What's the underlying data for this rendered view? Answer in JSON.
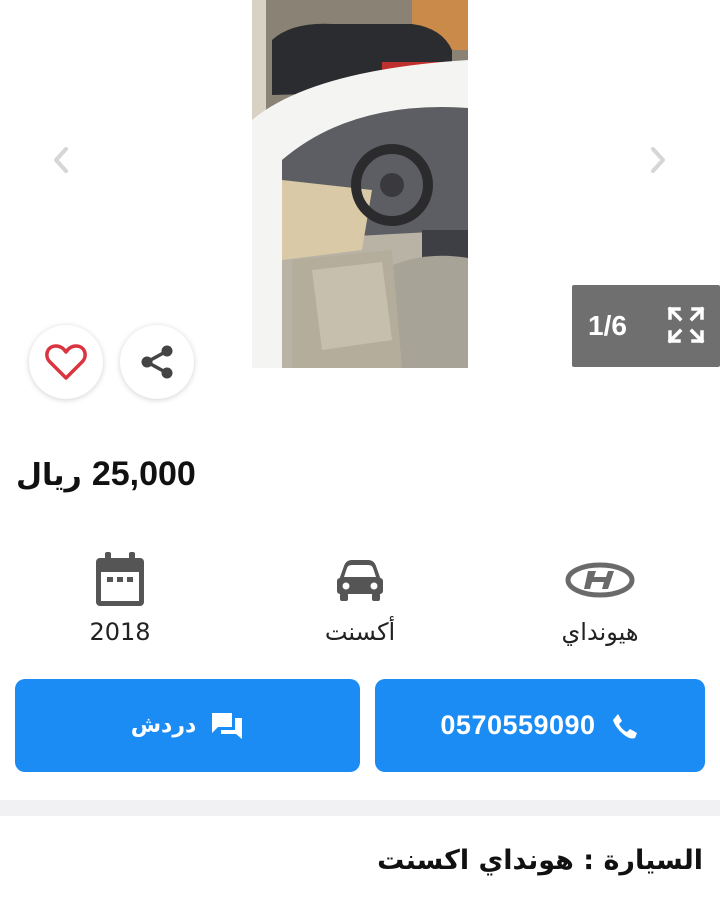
{
  "gallery": {
    "counter": "1/6",
    "prev_icon": "chevron-left-icon",
    "next_icon": "chevron-right-icon",
    "expand_icon": "expand-icon"
  },
  "actions": {
    "favorite_icon": "heart-icon",
    "share_icon": "share-icon"
  },
  "price": {
    "amount": "25,000",
    "currency": "ريال"
  },
  "specs": {
    "brand": "هيونداي",
    "model": "أكسنت",
    "year": "2018"
  },
  "buttons": {
    "call_number": "0570559090",
    "chat_label": "دردش"
  },
  "colors": {
    "primary": "#1a8cf4",
    "heart": "#d9343f"
  },
  "details": {
    "title": "السيارة : هونداي اكسنت"
  }
}
